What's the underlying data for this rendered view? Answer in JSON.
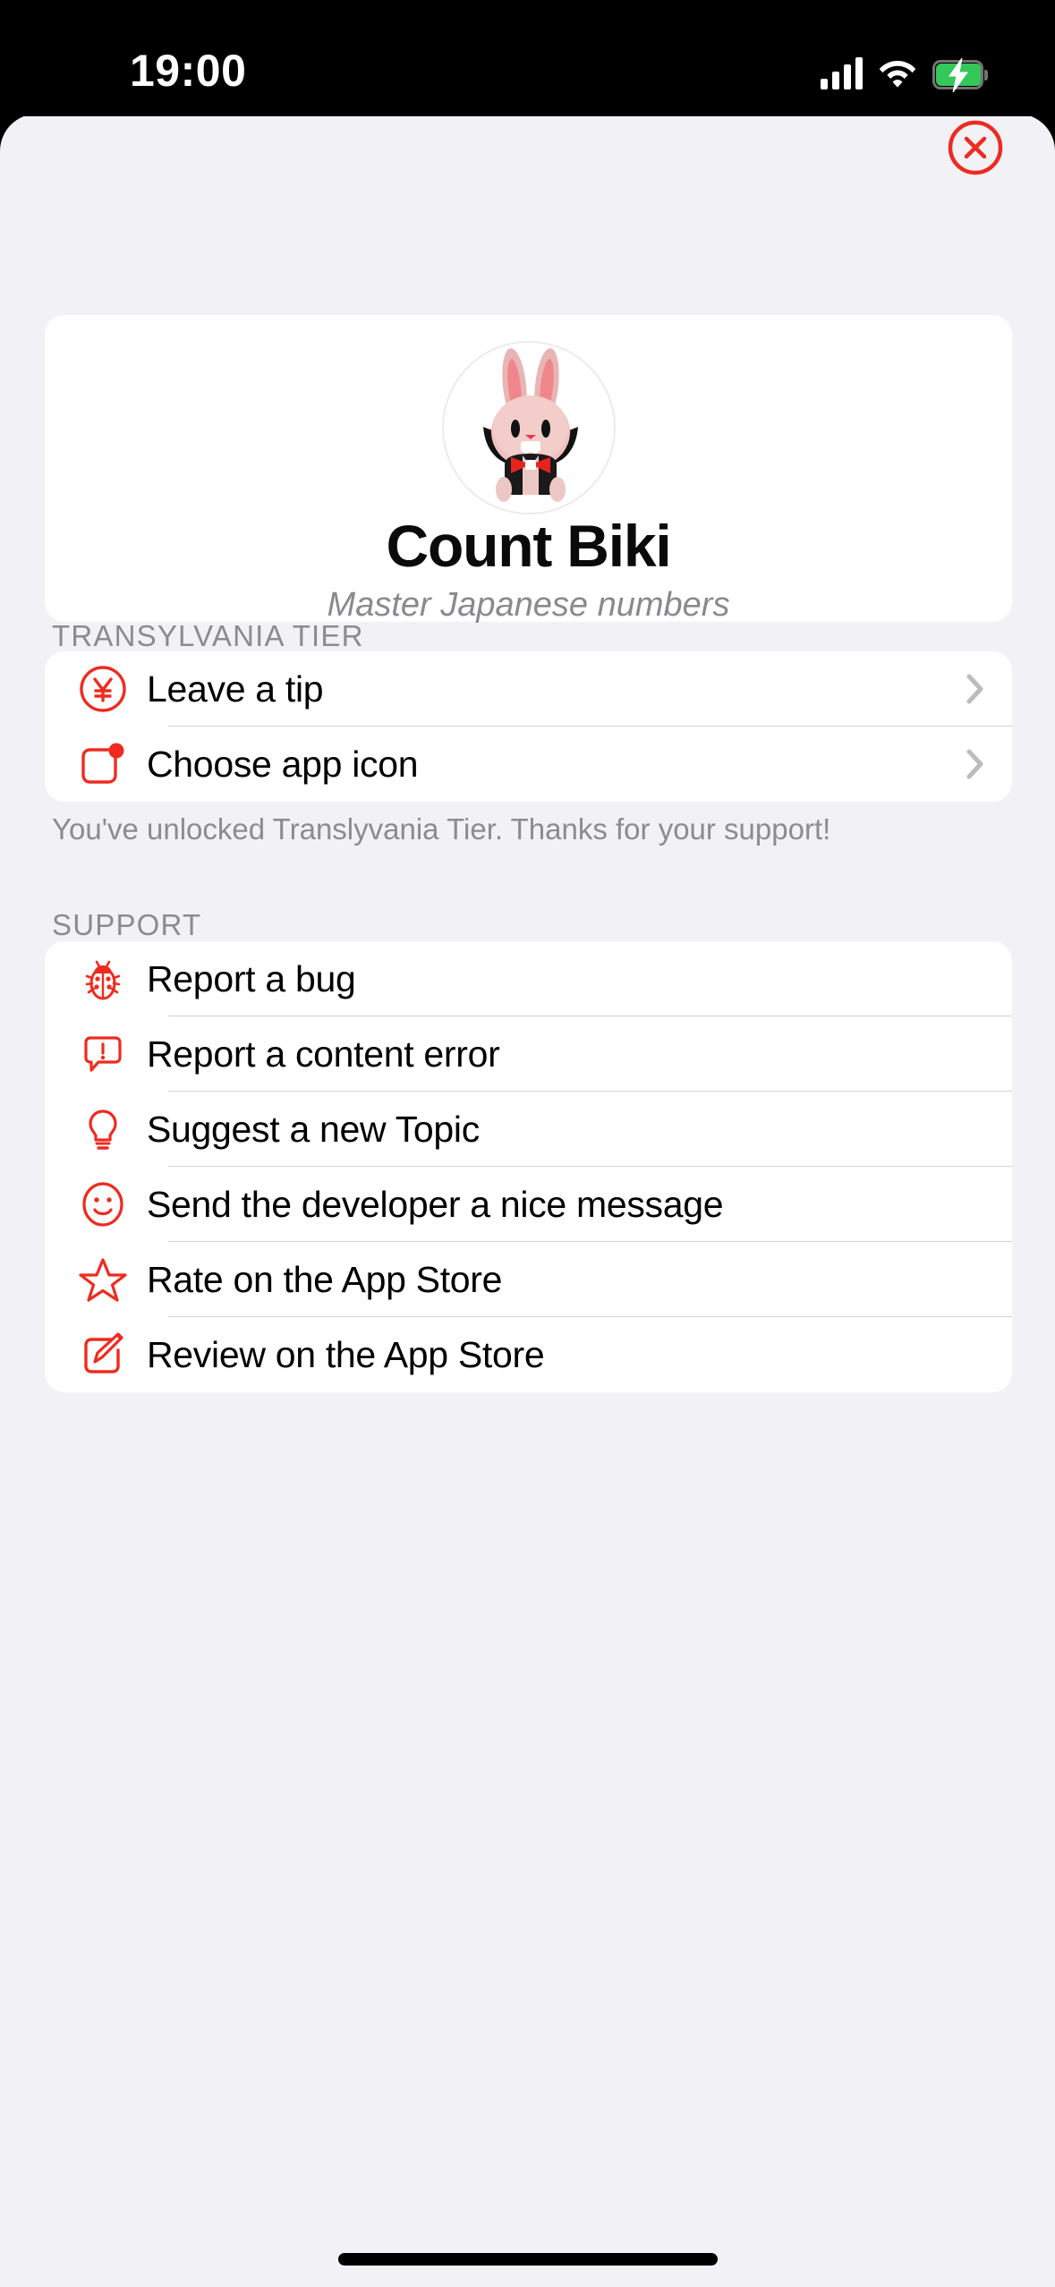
{
  "status_bar": {
    "time": "19:00",
    "cellular_icon": "cellular-bars-icon",
    "wifi_icon": "wifi-icon",
    "battery_icon": "battery-charging-icon",
    "battery_color": "#34C759"
  },
  "sheet": {
    "close_button_label": "×",
    "close_icon": "close-circle-icon",
    "accent_color": "#EE2B20",
    "background_color": "#F2F2F6"
  },
  "profile": {
    "avatar_icon": "vampire-bunny-avatar",
    "title": "Count Biki",
    "subtitle": "Master Japanese numbers"
  },
  "sections": [
    {
      "header": "TRANSYLVANIA TIER",
      "footer": "You've unlocked Translyvania Tier. Thanks for your support!",
      "rows": [
        {
          "icon": "yen-circle-icon",
          "label": "Leave a tip",
          "accessory": "chevron-right-icon"
        },
        {
          "icon": "app-badge-icon",
          "label": "Choose app icon",
          "accessory": "chevron-right-icon"
        }
      ]
    },
    {
      "header": "SUPPORT",
      "footer": "",
      "rows": [
        {
          "icon": "ladybug-icon",
          "label": "Report a bug",
          "accessory": ""
        },
        {
          "icon": "exclamation-bubble-icon",
          "label": "Report a content error",
          "accessory": ""
        },
        {
          "icon": "lightbulb-icon",
          "label": "Suggest a new Topic",
          "accessory": ""
        },
        {
          "icon": "smiley-face-icon",
          "label": "Send the developer a nice message",
          "accessory": ""
        },
        {
          "icon": "star-outline-icon",
          "label": "Rate on the App Store",
          "accessory": ""
        },
        {
          "icon": "square-pencil-icon",
          "label": "Review on the App Store",
          "accessory": ""
        }
      ]
    }
  ]
}
